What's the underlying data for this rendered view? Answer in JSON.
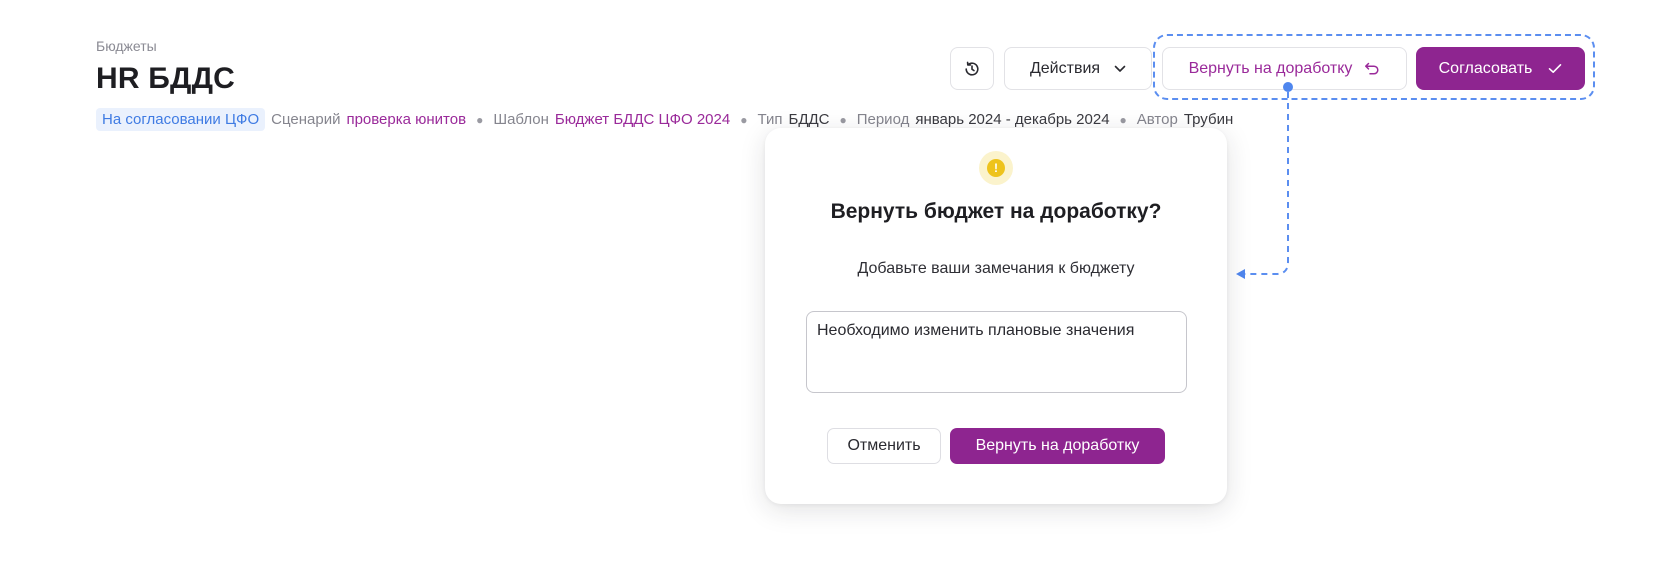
{
  "header": {
    "breadcrumb": "Бюджеты",
    "title": "HR БДДС"
  },
  "meta": {
    "status": "На согласовании ЦФО",
    "scenario_label": "Сценарий",
    "scenario_value": "проверка юнитов",
    "template_label": "Шаблон",
    "template_value": "Бюджет БДДС ЦФО 2024",
    "type_label": "Тип",
    "type_value": "БДДС",
    "period_label": "Период",
    "period_value": "январь 2024 - декабрь 2024",
    "author_label": "Автор",
    "author_value": "Трубин"
  },
  "toolbar": {
    "history_icon": "history-icon",
    "actions_label": "Действия",
    "return_label": "Вернуть на доработку",
    "approve_label": "Согласовать"
  },
  "modal": {
    "warning_icon": "warning-icon",
    "warning_glyph": "!",
    "title": "Вернуть бюджет на доработку?",
    "subtitle": "Добавьте ваши замечания к бюджету",
    "comment_value": "Необходимо изменить плановые значения",
    "cancel_label": "Отменить",
    "confirm_label": "Вернуть на доработку"
  },
  "colors": {
    "brand": "#8e2590",
    "link": "#9a2a9a",
    "status_bg": "#eaf1fd",
    "status_text": "#3f7be3",
    "highlight": "#5b8ef0",
    "warning": "#eec31c"
  }
}
